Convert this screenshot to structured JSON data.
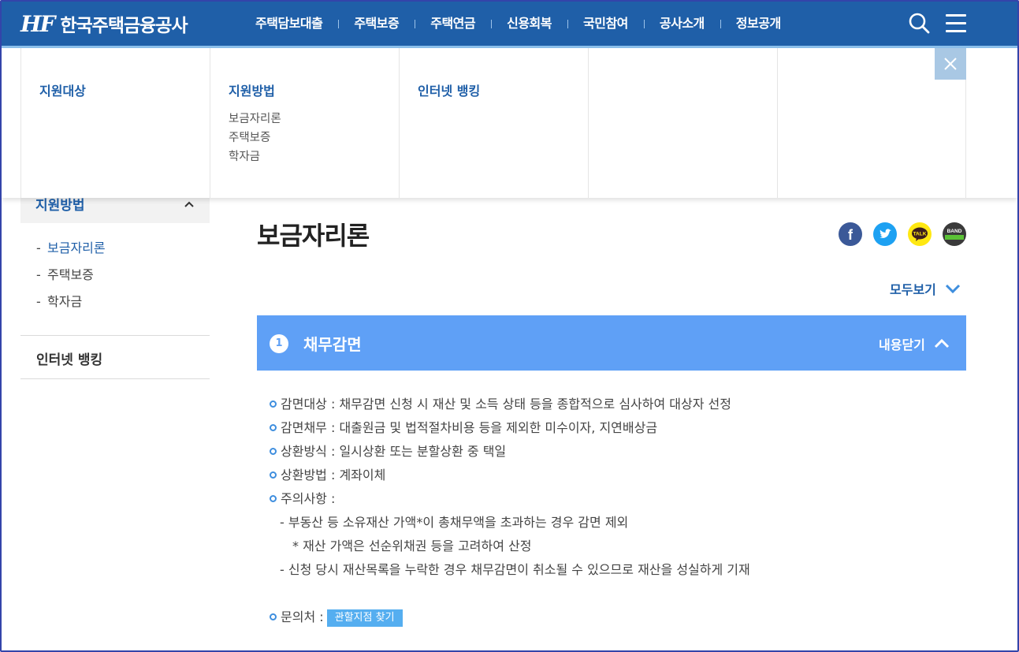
{
  "header": {
    "logo_mark": "HF",
    "logo_text": "한국주택금융공사",
    "nav": [
      "주택담보대출",
      "주택보증",
      "주택연금",
      "신용회복",
      "국민참여",
      "공사소개",
      "정보공개"
    ],
    "search_icon": "search-icon",
    "menu_icon": "hamburger-icon"
  },
  "mega_menu": {
    "columns": [
      {
        "title": "지원대상",
        "items": []
      },
      {
        "title": "지원방법",
        "items": [
          "보금자리론",
          "주택보증",
          "학자금"
        ]
      },
      {
        "title": "인터넷 뱅킹",
        "items": []
      },
      {
        "title": "",
        "items": []
      },
      {
        "title": "",
        "items": []
      }
    ],
    "close_icon": "close-icon"
  },
  "sidebar": {
    "section_label": "지원방법",
    "sub_items": [
      "보금자리론",
      "주택보증",
      "학자금"
    ],
    "active_index": 0,
    "second_section": "인터넷 뱅킹"
  },
  "main": {
    "title": "보금자리론",
    "share": [
      {
        "name": "facebook-icon",
        "glyph": "f",
        "color": "#3b5998"
      },
      {
        "name": "twitter-icon",
        "glyph": "t",
        "color": "#1da1f2"
      },
      {
        "name": "kakaotalk-icon",
        "glyph": "TALK",
        "color": "#ffe812"
      },
      {
        "name": "band-icon",
        "glyph": "BAND",
        "color": "#3a3a3a"
      }
    ],
    "view_all": "모두보기",
    "accordion": {
      "number": "1",
      "title": "채무감면",
      "toggle_label": "내용닫기",
      "lines": [
        "감면대상 : 채무감면 신청 시 재산 및 소득 상태 등을 종합적으로 심사하여 대상자 선정",
        "감면채무 : 대출원금 및 법적절차비용 등을 제외한 미수이자, 지연배상금",
        "상환방식 : 일시상환 또는 분할상환 중 택일",
        "상환방법 : 계좌이체",
        "주의사항 :"
      ],
      "notes": [
        "- 부동산 등 소유재산 가액*이 총채무액을 초과하는 경우 감면 제외",
        "* 재산 가액은 선순위채권 등을 고려하여 산정",
        "- 신청 당시 재산목록을 누락한 경우 채무감면이 취소될 수 있으므로 재산을 성실하게 기재"
      ],
      "contact_label": "문의처 :",
      "contact_button": "관할지점 찾기"
    }
  },
  "colors": {
    "header_bg": "#1f5fa8",
    "accent": "#5fa0f6",
    "bullet": "#3e8ede",
    "find_button": "#55aef0"
  }
}
